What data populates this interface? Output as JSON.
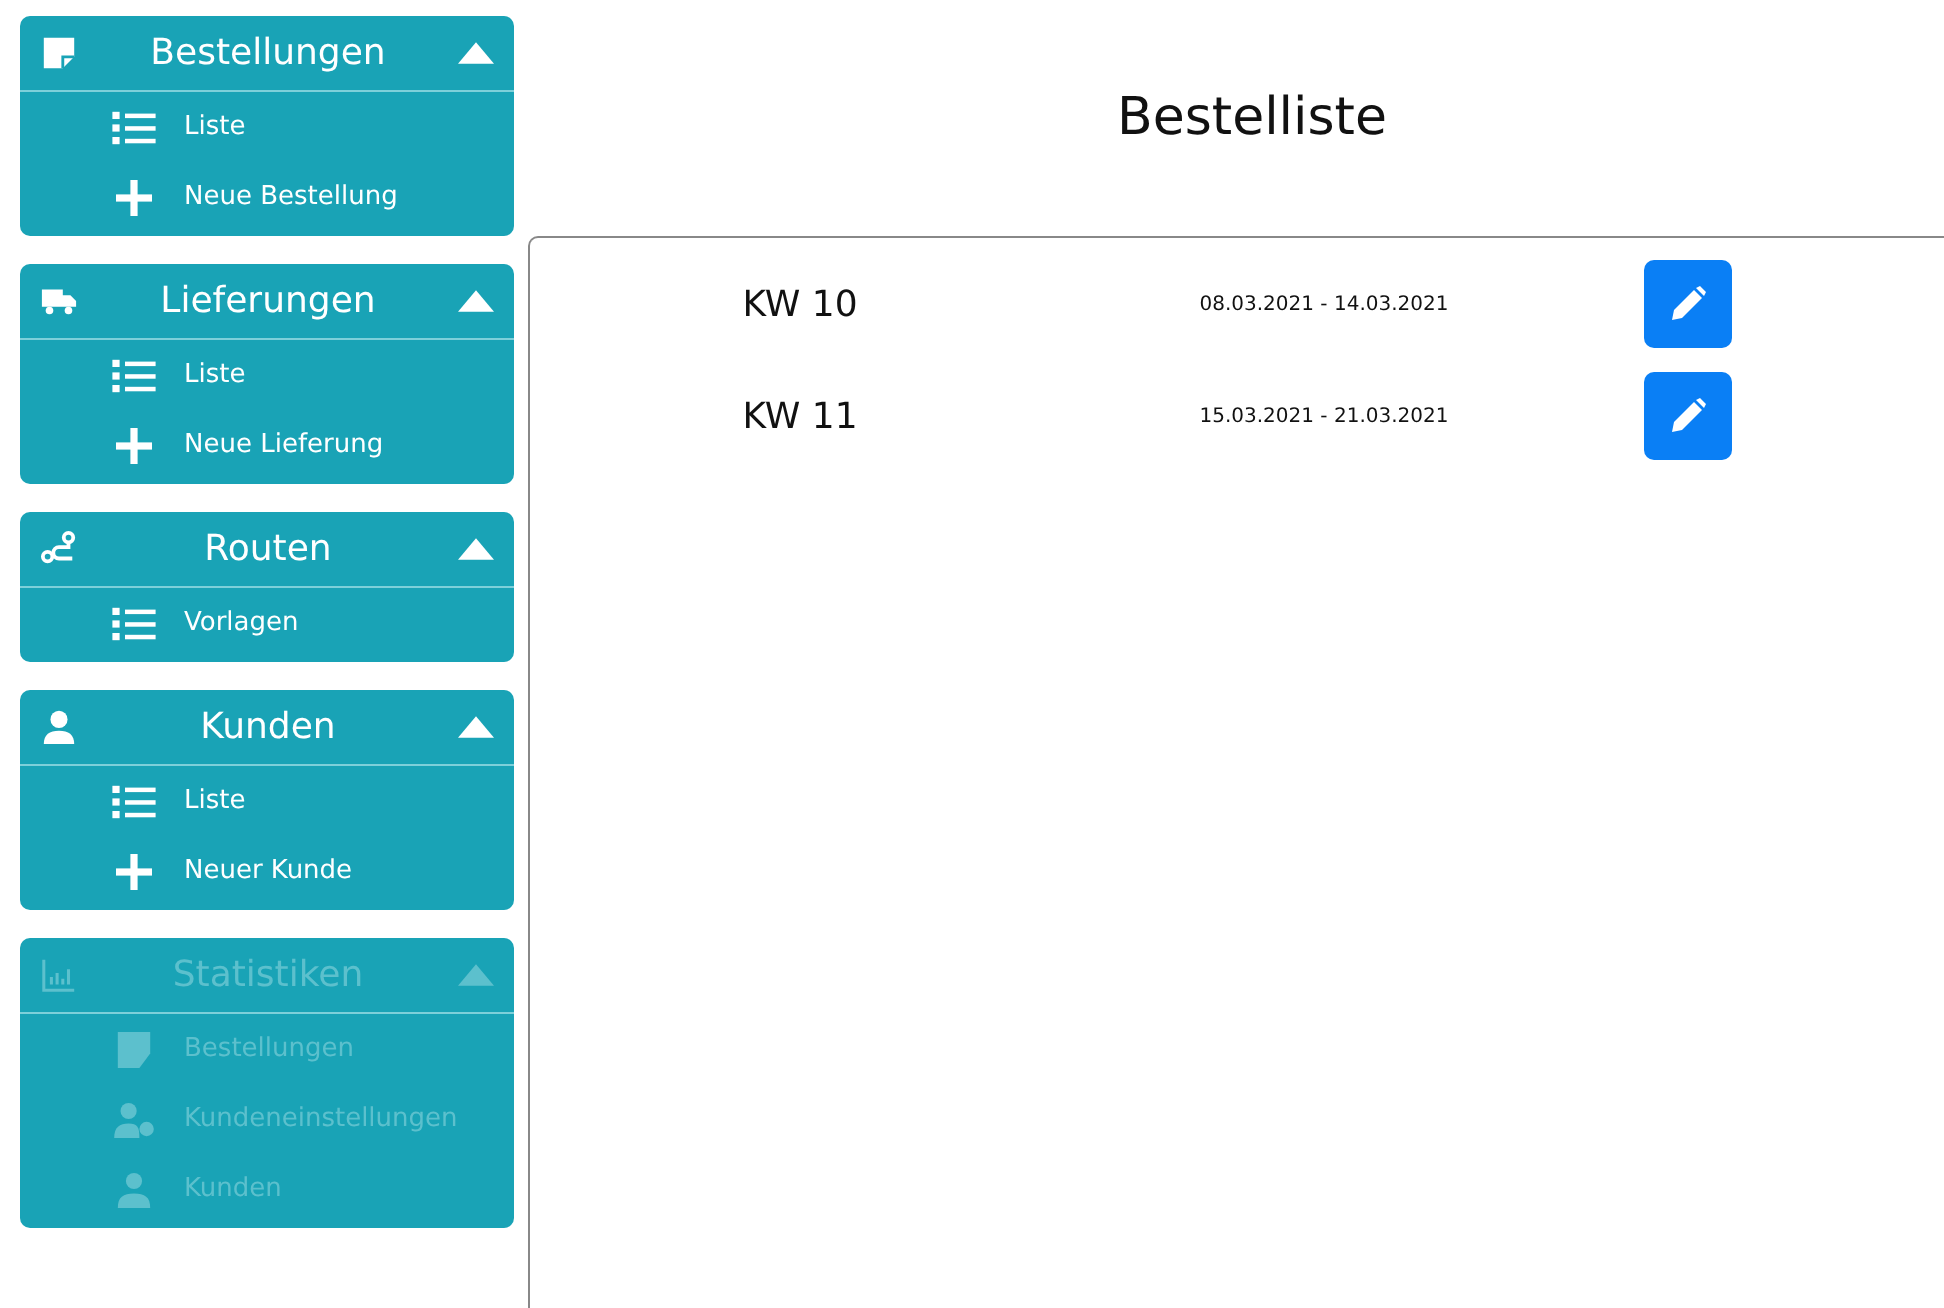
{
  "sidebar": {
    "sections": [
      {
        "title": "Bestellungen",
        "kind": "note",
        "expanded": true,
        "disabled": false,
        "items": [
          {
            "label": "Liste",
            "kind": "list"
          },
          {
            "label": "Neue Bestellung",
            "kind": "plus"
          }
        ]
      },
      {
        "title": "Lieferungen",
        "kind": "truck",
        "expanded": true,
        "disabled": false,
        "items": [
          {
            "label": "Liste",
            "kind": "list"
          },
          {
            "label": "Neue Lieferung",
            "kind": "plus"
          }
        ]
      },
      {
        "title": "Routen",
        "kind": "route",
        "expanded": true,
        "disabled": false,
        "items": [
          {
            "label": "Vorlagen",
            "kind": "list"
          }
        ]
      },
      {
        "title": "Kunden",
        "kind": "user",
        "expanded": true,
        "disabled": false,
        "items": [
          {
            "label": "Liste",
            "kind": "list"
          },
          {
            "label": "Neuer Kunde",
            "kind": "plus"
          }
        ]
      },
      {
        "title": "Statistiken",
        "kind": "chart",
        "expanded": true,
        "disabled": true,
        "items": [
          {
            "label": "Bestellungen",
            "kind": "note"
          },
          {
            "label": "Kundeneinstellungen",
            "kind": "usergear"
          },
          {
            "label": "Kunden",
            "kind": "user"
          }
        ]
      }
    ]
  },
  "page": {
    "title": "Bestelliste"
  },
  "weeks": [
    {
      "week": "KW 10",
      "range": "08.03.2021 - 14.03.2021"
    },
    {
      "week": "KW 11",
      "range": "15.03.2021 - 21.03.2021"
    }
  ]
}
